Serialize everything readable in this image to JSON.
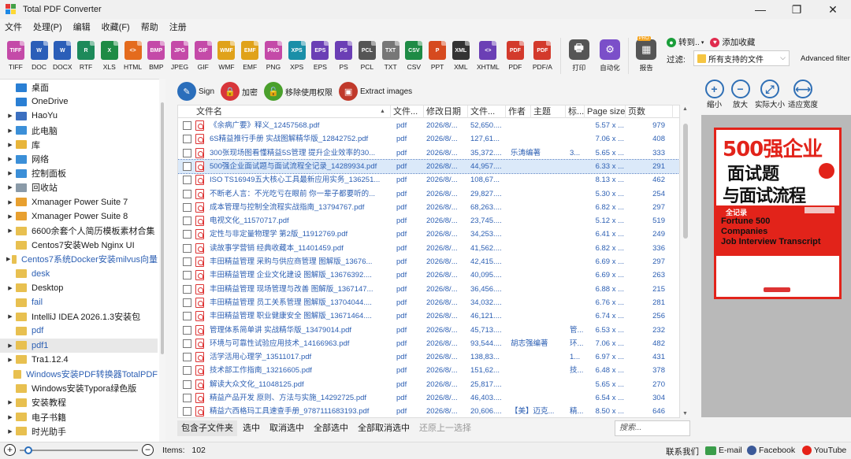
{
  "app": {
    "title": "Total PDF Converter"
  },
  "window": {
    "minimize": "—",
    "maximize": "❐",
    "close": "✕"
  },
  "menu": [
    "文件",
    "处理(P)",
    "编辑",
    "收藏(F)",
    "帮助",
    "注册"
  ],
  "toolbar": [
    {
      "label": "TIFF",
      "color": "#c44aa8",
      "text": "TIFF"
    },
    {
      "label": "DOC",
      "color": "#2b5eb8",
      "text": "W"
    },
    {
      "label": "DOCX",
      "color": "#2b5eb8",
      "text": "W"
    },
    {
      "label": "RTF",
      "color": "#1d8a5a",
      "text": "R"
    },
    {
      "label": "XLS",
      "color": "#1e8b45",
      "text": "X"
    },
    {
      "label": "HTML",
      "color": "#e46b1d",
      "text": "<>"
    },
    {
      "label": "BMP",
      "color": "#c44aa8",
      "text": "BMP"
    },
    {
      "label": "JPEG",
      "color": "#c44aa8",
      "text": "JPG"
    },
    {
      "label": "GIF",
      "color": "#c44aa8",
      "text": "GIF"
    },
    {
      "label": "WMF",
      "color": "#e0a21a",
      "text": "WMF"
    },
    {
      "label": "EMF",
      "color": "#e0a21a",
      "text": "EMF"
    },
    {
      "label": "PNG",
      "color": "#c44aa8",
      "text": "PNG"
    },
    {
      "label": "XPS",
      "color": "#1a8fa8",
      "text": "XPS"
    },
    {
      "label": "EPS",
      "color": "#6b3fb5",
      "text": "EPS"
    },
    {
      "label": "PS",
      "color": "#6b3fb5",
      "text": "PS"
    },
    {
      "label": "PCL",
      "color": "#555555",
      "text": "PCL"
    },
    {
      "label": "TXT",
      "color": "#777777",
      "text": "TXT"
    },
    {
      "label": "CSV",
      "color": "#1e8b45",
      "text": "CSV"
    },
    {
      "label": "PPT",
      "color": "#d64a1f",
      "text": "P"
    },
    {
      "label": "XML",
      "color": "#333333",
      "text": "XML"
    },
    {
      "label": "XHTML",
      "color": "#6b3fb5",
      "text": "<>"
    },
    {
      "label": "PDF",
      "color": "#d33a2c",
      "text": "PDF"
    },
    {
      "label": "PDF/A",
      "color": "#d33a2c",
      "text": "PDF"
    }
  ],
  "toolbar_extra": {
    "print": "打印",
    "auto": "自动化",
    "report": "报告",
    "pro_badge": "PRO"
  },
  "right_top": {
    "goto": "转到..",
    "add_fav": "添加收藏",
    "filter_label": "过滤:",
    "filter_value": "所有支持的文件",
    "advanced": "Advanced filter"
  },
  "tree": [
    {
      "label": "桌面",
      "color": "#2a7fd4",
      "arrow": "",
      "sel": false,
      "blue": false
    },
    {
      "label": "OneDrive",
      "color": "#2a7fd4",
      "arrow": "",
      "sel": false,
      "blue": false
    },
    {
      "label": "HaoYu",
      "color": "#3b6fc0",
      "arrow": "▶",
      "sel": false,
      "blue": false
    },
    {
      "label": "此电脑",
      "color": "#3b8fd8",
      "arrow": "▶",
      "sel": false,
      "blue": false
    },
    {
      "label": "库",
      "color": "#e8b53a",
      "arrow": "▶",
      "sel": false,
      "blue": false
    },
    {
      "label": "网络",
      "color": "#3b8fd8",
      "arrow": "▶",
      "sel": false,
      "blue": false
    },
    {
      "label": "控制面板",
      "color": "#3b8fd8",
      "arrow": "▶",
      "sel": false,
      "blue": false
    },
    {
      "label": "回收站",
      "color": "#8a9aa8",
      "arrow": "▶",
      "sel": false,
      "blue": false
    },
    {
      "label": "Xmanager Power Suite 7",
      "color": "#e8a030",
      "arrow": "▶",
      "sel": false,
      "blue": false
    },
    {
      "label": "Xmanager Power Suite 8",
      "color": "#e8a030",
      "arrow": "▶",
      "sel": false,
      "blue": false
    },
    {
      "label": "6600余套个人简历模板素材合集",
      "color": "#e8c050",
      "arrow": "▶",
      "sel": false,
      "blue": false
    },
    {
      "label": "Centos7安装Web Nginx UI",
      "color": "#e8c050",
      "arrow": "",
      "sel": false,
      "blue": false
    },
    {
      "label": "Centos7系统Docker安装milvus向量",
      "color": "#e8c050",
      "arrow": "▶",
      "sel": false,
      "blue": true
    },
    {
      "label": "desk",
      "color": "#e8c050",
      "arrow": "",
      "sel": false,
      "blue": true
    },
    {
      "label": "Desktop",
      "color": "#e8c050",
      "arrow": "▶",
      "sel": false,
      "blue": false
    },
    {
      "label": "fail",
      "color": "#e8c050",
      "arrow": "",
      "sel": false,
      "blue": true
    },
    {
      "label": "IntelliJ IDEA 2026.1.3安装包",
      "color": "#e8c050",
      "arrow": "▶",
      "sel": false,
      "blue": false
    },
    {
      "label": "pdf",
      "color": "#e8c050",
      "arrow": "",
      "sel": false,
      "blue": true
    },
    {
      "label": "pdf1",
      "color": "#e8c050",
      "arrow": "▶",
      "sel": true,
      "blue": true
    },
    {
      "label": "Tra1.12.4",
      "color": "#e8c050",
      "arrow": "▶",
      "sel": false,
      "blue": false
    },
    {
      "label": "Windows安装PDF转换器TotalPDF",
      "color": "#e8c050",
      "arrow": "",
      "sel": false,
      "blue": true
    },
    {
      "label": "Windows安装Typora绿色版",
      "color": "#e8c050",
      "arrow": "",
      "sel": false,
      "blue": false
    },
    {
      "label": "安装教程",
      "color": "#e8c050",
      "arrow": "▶",
      "sel": false,
      "blue": false
    },
    {
      "label": "电子书籍",
      "color": "#e8c050",
      "arrow": "▶",
      "sel": false,
      "blue": false
    },
    {
      "label": "时光助手",
      "color": "#e8c050",
      "arrow": "▶",
      "sel": false,
      "blue": false
    }
  ],
  "actions": [
    {
      "label": "Sign",
      "color": "#2a6ebb",
      "icon": "✎"
    },
    {
      "label": "加密",
      "color": "#d8363b",
      "icon": "🔒"
    },
    {
      "label": "移除使用权限",
      "color": "#4aa02c",
      "icon": "🔓"
    },
    {
      "label": "Extract images",
      "color": "#c0392b",
      "icon": "▣"
    }
  ],
  "zoom_buttons": [
    {
      "label": "缩小",
      "icon": "+"
    },
    {
      "label": "放大",
      "icon": "−"
    },
    {
      "label": "实际大小",
      "icon": "⤢"
    },
    {
      "label": "适应宽度",
      "icon": "⟷"
    }
  ],
  "columns": [
    "文件名",
    "文件...",
    "修改日期",
    "文件...",
    "作者",
    "主题",
    "标...",
    "Page size",
    "页数"
  ],
  "rows": [
    {
      "name": "《余病广要》释义_12457568.pdf",
      "type": "pdf",
      "date": "2026/8/...",
      "size": "52,650....",
      "author": "",
      "subject": "",
      "kw": "",
      "page": "5.57 x ...",
      "pages": "979",
      "sel": false
    },
    {
      "name": "6S精益推行手册 实战图解精华版_12842752.pdf",
      "type": "pdf",
      "date": "2026/8/...",
      "size": "127,61...",
      "author": "",
      "subject": "",
      "kw": "",
      "page": "7.06 x ...",
      "pages": "408",
      "sel": false
    },
    {
      "name": "300张现场图看懂精益5S管理 提升企业效率的30...",
      "type": "pdf",
      "date": "2026/8/...",
      "size": "35,372....",
      "author": "乐涛编著",
      "subject": "",
      "kw": "3...",
      "page": "5.65 x ...",
      "pages": "333",
      "sel": false
    },
    {
      "name": "500强企业面试题与面试流程全记录_14289934.pdf",
      "type": "pdf",
      "date": "2026/8/...",
      "size": "44,957....",
      "author": "",
      "subject": "",
      "kw": "",
      "page": "6.33 x ...",
      "pages": "291",
      "sel": true
    },
    {
      "name": "ISO TS16949五大核心工具最新应用实务_136251...",
      "type": "pdf",
      "date": "2026/8/...",
      "size": "108,67...",
      "author": "",
      "subject": "",
      "kw": "",
      "page": "8.13 x ...",
      "pages": "462",
      "sel": false
    },
    {
      "name": "不断老人言：不光吃亏在眼前 你一辈子都要听的...",
      "type": "pdf",
      "date": "2026/8/...",
      "size": "29,827....",
      "author": "",
      "subject": "",
      "kw": "",
      "page": "5.30 x ...",
      "pages": "254",
      "sel": false
    },
    {
      "name": "成本管理与控制全流程实战指南_13794767.pdf",
      "type": "pdf",
      "date": "2026/8/...",
      "size": "68,263....",
      "author": "",
      "subject": "",
      "kw": "",
      "page": "6.82 x ...",
      "pages": "297",
      "sel": false
    },
    {
      "name": "电视文化_11570717.pdf",
      "type": "pdf",
      "date": "2026/8/...",
      "size": "23,745....",
      "author": "",
      "subject": "",
      "kw": "",
      "page": "5.12 x ...",
      "pages": "519",
      "sel": false
    },
    {
      "name": "定性与非定量物理学 第2版_11912769.pdf",
      "type": "pdf",
      "date": "2026/8/...",
      "size": "34,253....",
      "author": "",
      "subject": "",
      "kw": "",
      "page": "6.41 x ...",
      "pages": "249",
      "sel": false
    },
    {
      "name": "读故事学营销 经典收藏本_11401459.pdf",
      "type": "pdf",
      "date": "2026/8/...",
      "size": "41,562....",
      "author": "",
      "subject": "",
      "kw": "",
      "page": "6.82 x ...",
      "pages": "336",
      "sel": false
    },
    {
      "name": "丰田精益管理 采购与供应商管理 图解版_13676...",
      "type": "pdf",
      "date": "2026/8/...",
      "size": "42,415....",
      "author": "",
      "subject": "",
      "kw": "",
      "page": "6.69 x ...",
      "pages": "297",
      "sel": false
    },
    {
      "name": "丰田精益管理 企业文化建设 图解版_13676392....",
      "type": "pdf",
      "date": "2026/8/...",
      "size": "40,095....",
      "author": "",
      "subject": "",
      "kw": "",
      "page": "6.69 x ...",
      "pages": "263",
      "sel": false
    },
    {
      "name": "丰田精益管理 现场管理与改善 图解版_1367147...",
      "type": "pdf",
      "date": "2026/8/...",
      "size": "36,456....",
      "author": "",
      "subject": "",
      "kw": "",
      "page": "6.88 x ...",
      "pages": "215",
      "sel": false
    },
    {
      "name": "丰田精益管理 员工关系管理 图解版_13704044....",
      "type": "pdf",
      "date": "2026/8/...",
      "size": "34,032....",
      "author": "",
      "subject": "",
      "kw": "",
      "page": "6.76 x ...",
      "pages": "281",
      "sel": false
    },
    {
      "name": "丰田精益管理 职业健康安全 图解版_13671464....",
      "type": "pdf",
      "date": "2026/8/...",
      "size": "46,121....",
      "author": "",
      "subject": "",
      "kw": "",
      "page": "6.74 x ...",
      "pages": "256",
      "sel": false
    },
    {
      "name": "管理体系简单讲 实战精华版_13479014.pdf",
      "type": "pdf",
      "date": "2026/8/...",
      "size": "45,713....",
      "author": "",
      "subject": "",
      "kw": "管...",
      "page": "6.53 x ...",
      "pages": "232",
      "sel": false
    },
    {
      "name": "环境与可靠性试验应用技术_14166963.pdf",
      "type": "pdf",
      "date": "2026/8/...",
      "size": "93,544....",
      "author": "胡志强编著",
      "subject": "",
      "kw": "环...",
      "page": "7.06 x ...",
      "pages": "482",
      "sel": false
    },
    {
      "name": "活学活用心理学_13511017.pdf",
      "type": "pdf",
      "date": "2026/8/...",
      "size": "138,83...",
      "author": "",
      "subject": "",
      "kw": "1...",
      "page": "6.97 x ...",
      "pages": "431",
      "sel": false
    },
    {
      "name": "技术部工作指南_13216605.pdf",
      "type": "pdf",
      "date": "2026/8/...",
      "size": "151,62...",
      "author": "",
      "subject": "",
      "kw": "技...",
      "page": "6.48 x ...",
      "pages": "378",
      "sel": false
    },
    {
      "name": "解读大众文化_11048125.pdf",
      "type": "pdf",
      "date": "2026/8/...",
      "size": "25,817....",
      "author": "",
      "subject": "",
      "kw": "",
      "page": "5.65 x ...",
      "pages": "270",
      "sel": false
    },
    {
      "name": "精益产品开发 原则、方法与实施_14292725.pdf",
      "type": "pdf",
      "date": "2026/8/...",
      "size": "46,403....",
      "author": "",
      "subject": "",
      "kw": "",
      "page": "6.54 x ...",
      "pages": "304",
      "sel": false
    },
    {
      "name": "精益六西格玛工具速查手册_9787111683193.pdf",
      "type": "pdf",
      "date": "2026/8/...",
      "size": "20,606....",
      "author": "【美】迈克...",
      "subject": "",
      "kw": "精...",
      "page": "8.50 x ...",
      "pages": "646",
      "sel": false
    }
  ],
  "bottom": {
    "include_sub": "包含子文件夹",
    "select": "选中",
    "deselect": "取消选中",
    "select_all": "全部选中",
    "deselect_all": "全部取消选中",
    "restore": "还原上一选择",
    "search_placeholder": "搜索..."
  },
  "preview_book": {
    "l1": "500强企业",
    "l2": "面试题",
    "l3": "与面试流程",
    "l4": "全记录",
    "l5a": "Fortune 500",
    "l5b": "Companies",
    "l5c": "Job Interview Transcript"
  },
  "status": {
    "items_label": "Items:",
    "items_value": "102",
    "contact": "联系我们",
    "email": "E-mail",
    "facebook": "Facebook",
    "youtube": "YouTube"
  }
}
